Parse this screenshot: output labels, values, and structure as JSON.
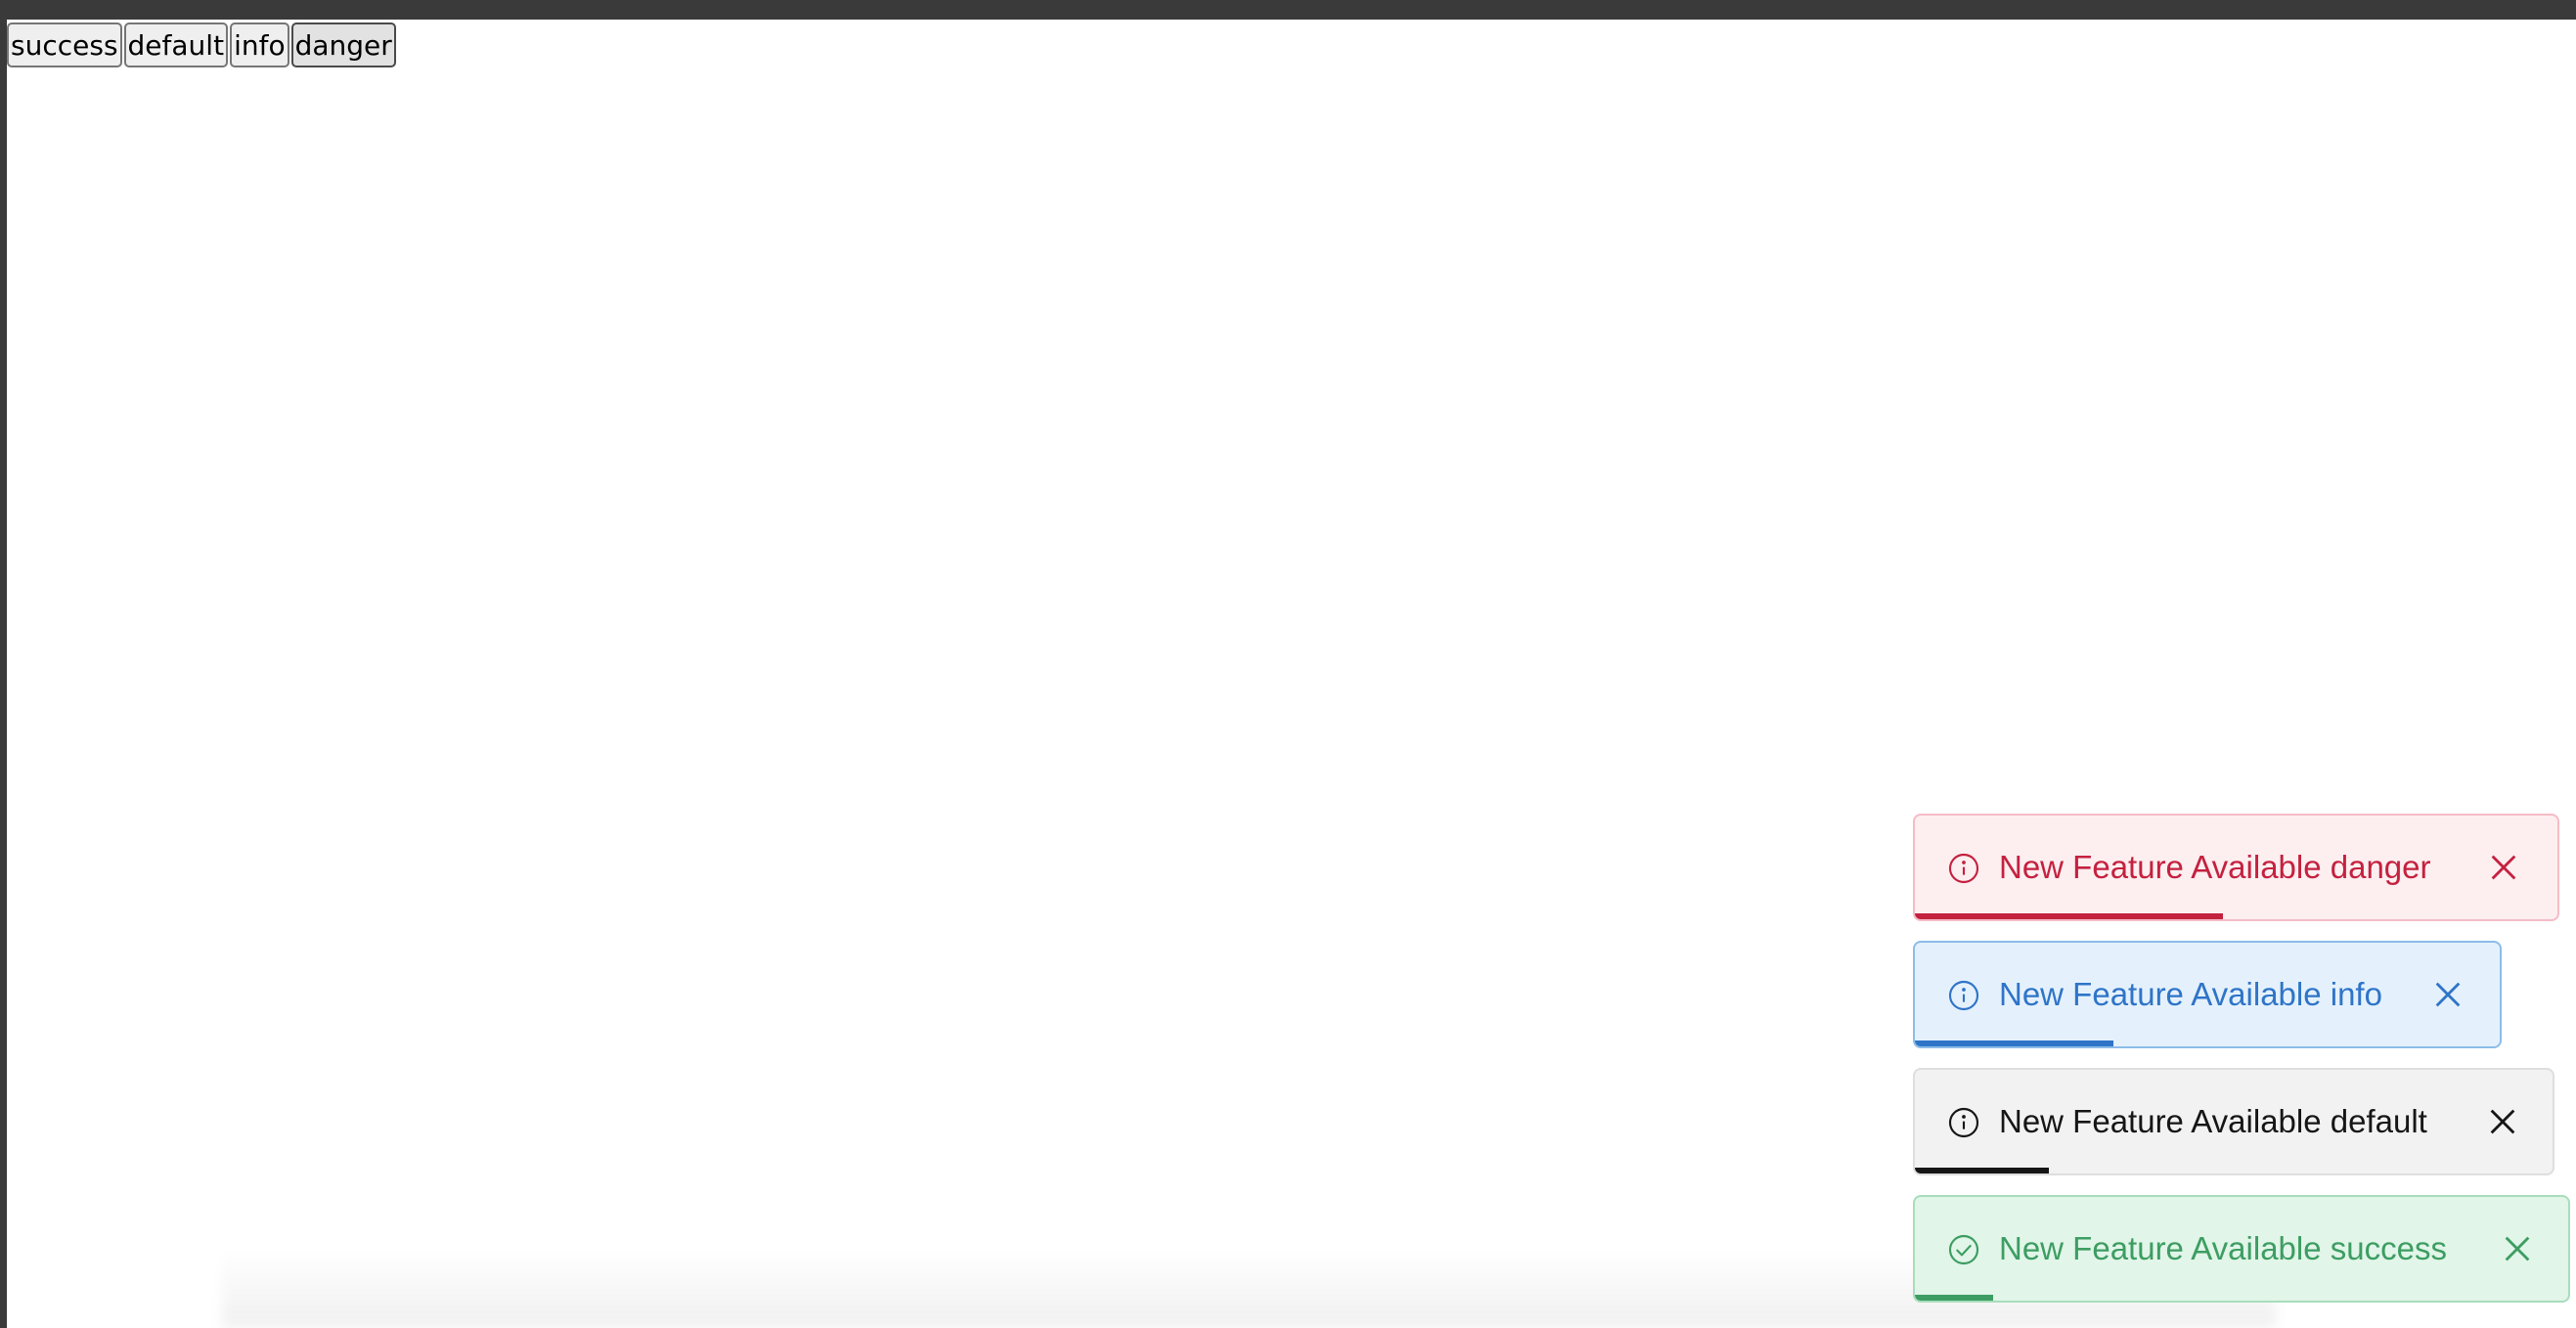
{
  "buttons": [
    {
      "label": "success"
    },
    {
      "label": "default"
    },
    {
      "label": "info"
    },
    {
      "label": "danger"
    }
  ],
  "toasts": [
    {
      "type": "danger",
      "message": "New Feature Available danger",
      "icon": "info-circle-icon",
      "progress_fraction": 0.48,
      "color": "#c4213f"
    },
    {
      "type": "info",
      "message": "New Feature Available info",
      "icon": "info-circle-icon",
      "progress_fraction": 0.34,
      "color": "#2f74c8"
    },
    {
      "type": "default",
      "message": "New Feature Available default",
      "icon": "info-circle-icon",
      "progress_fraction": 0.21,
      "color": "#161616"
    },
    {
      "type": "success",
      "message": "New Feature Available success",
      "icon": "check-circle-icon",
      "progress_fraction": 0.12,
      "color": "#3d9d62"
    }
  ]
}
